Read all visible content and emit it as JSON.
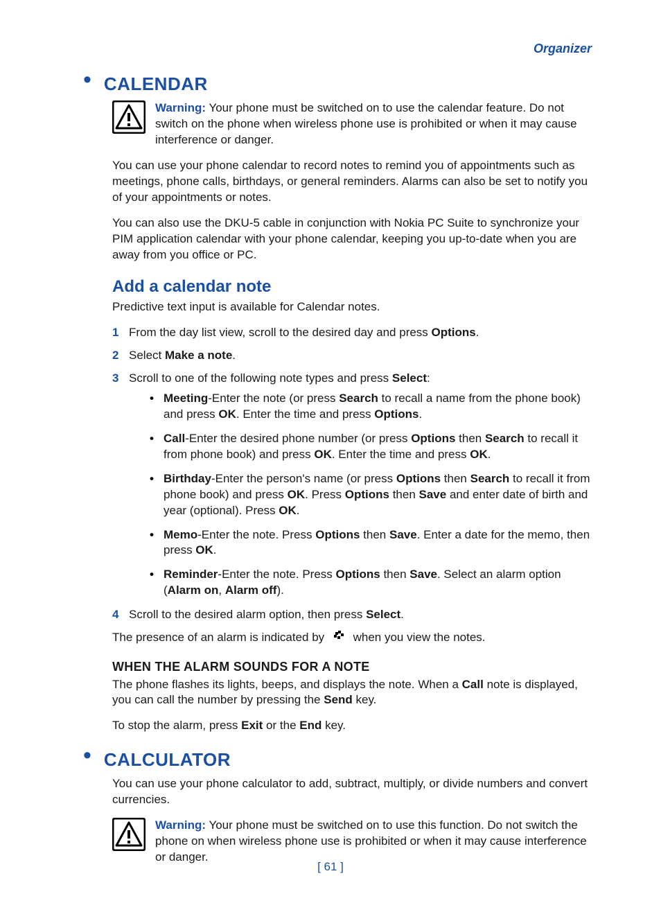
{
  "chapter": "Organizer",
  "pagenum": "[ 61 ]",
  "sections": [
    {
      "title": "CALENDAR",
      "warning": {
        "label": "Warning:",
        "text": "Your phone must be switched on to use the calendar feature. Do not switch on the phone when wireless phone use is prohibited or when it may cause interference or danger."
      },
      "paras": [
        "You can use your phone calendar to record notes to remind you of appointments such as meetings, phone calls, birthdays, or general reminders. Alarms can also be set to notify you of your appointments or notes.",
        "You can also use the DKU-5 cable in conjunction with Nokia PC Suite to synchronize your PIM application calendar with your phone calendar, keeping you up-to-date when you are away from you office or PC."
      ],
      "subsections": [
        {
          "title": "Add a calendar note",
          "intro": "Predictive text input is available for Calendar notes.",
          "steps": [
            {
              "num": "1",
              "html": "From the day list view, scroll to the desired day and press <b>Options</b>."
            },
            {
              "num": "2",
              "html": "Select <b>Make a note</b>."
            },
            {
              "num": "3",
              "html": "Scroll to one of the following note types and press <b>Select</b>:",
              "bullets": [
                "<b>Meeting</b>-Enter the note (or press <b>Search</b> to recall a name from the phone book) and press <b>OK</b>. Enter the time and press <b>Options</b>.",
                "<b>Call</b>-Enter the desired phone number (or press <b>Options</b> then <b>Search</b> to recall it from phone book) and press <b>OK</b>. Enter the time and press <b>OK</b>.",
                "<b>Birthday</b>-Enter the person's name (or press <b>Options</b> then <b>Search</b> to recall it from phone book) and press <b>OK</b>. Press <b>Options</b> then <b>Save</b> and enter date of birth and year (optional). Press <b>OK</b>.",
                "<b>Memo</b>-Enter the note. Press <b>Options</b> then <b>Save</b>. Enter a date for the memo, then press <b>OK</b>.",
                "<b>Reminder</b>-Enter the note. Press <b>Options</b> then <b>Save</b>. Select an alarm option (<b>Alarm on</b>, <b>Alarm off</b>)."
              ]
            },
            {
              "num": "4",
              "html": "Scroll to the desired alarm option, then press <b>Select</b>."
            }
          ],
          "after_steps_html": "The presence of an alarm is indicated by {ICON} when you view the notes.",
          "sub3": {
            "title": "WHEN THE ALARM SOUNDS FOR A NOTE",
            "paras": [
              "The phone flashes its lights, beeps, and displays the note. When a <b>Call</b> note is displayed, you can call the number by pressing the <b>Send</b> key.",
              "To stop the alarm, press <b>Exit</b> or the <b>End</b> key."
            ]
          }
        }
      ]
    },
    {
      "title": "CALCULATOR",
      "intro": "You can use your phone calculator to add, subtract, multiply, or divide numbers and convert currencies.",
      "warning": {
        "label": "Warning:",
        "text": "Your phone must be switched on to use this function. Do not switch the phone on when wireless phone use is prohibited or when it may cause interference or danger."
      }
    }
  ]
}
